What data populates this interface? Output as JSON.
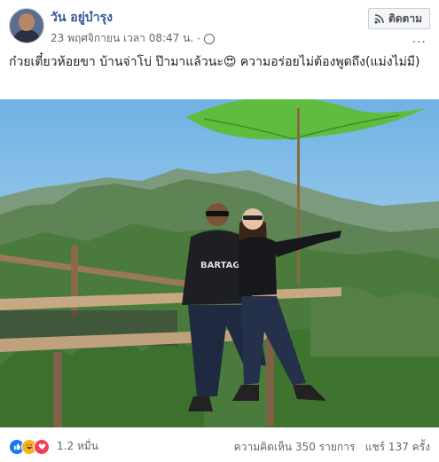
{
  "post": {
    "author": "วัน อยู่บำรุง",
    "date": "23 พฤศจิกายน เวลา 08:47 น.",
    "dot": "·",
    "follow_label": "ติดตาม",
    "more": "...",
    "caption": "ก๋วยเตี๋ยวห้อยขา บ้านจ่าโบ่ ป๊ามาแล้วนะ😍 ความอร่อยไม่ต้องพูดถึง(แม่งไม่มี)"
  },
  "photo": {
    "shirt_text": "BARTAG"
  },
  "footer": {
    "reaction_count": "1.2 หมื่น",
    "comments": "ความคิดเห็น 350 รายการ",
    "shares": "แชร์ 137 ครั้ง"
  },
  "colors": {
    "author_blue": "#385898",
    "sky": "#8fc3e8",
    "umbrella": "#5ebd3e"
  },
  "icons": [
    "rss-follow-icon",
    "globe-icon",
    "like-icon",
    "haha-icon",
    "love-icon"
  ]
}
